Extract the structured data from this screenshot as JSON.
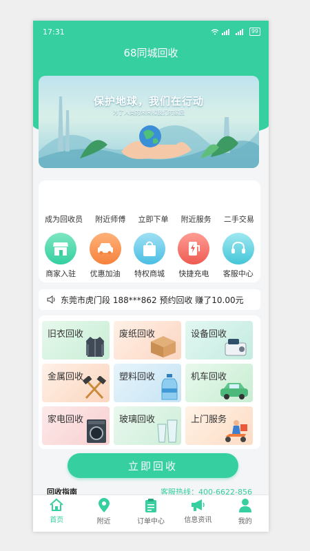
{
  "status": {
    "time": "17:31",
    "network": "⁴ᴳ",
    "battery": "99"
  },
  "app": {
    "title": "68同城回收"
  },
  "banner": {
    "title": "保护地球，我们在行动",
    "subtitle": "为了人类的未来和我们的家园"
  },
  "quick_links": [
    "成为回收员",
    "附近师傅",
    "立即下单",
    "附近服务",
    "二手交易"
  ],
  "services": [
    {
      "label": "商家入驻",
      "icon": "shop-icon",
      "color": "#4fd6a3"
    },
    {
      "label": "优惠加油",
      "icon": "car-icon",
      "color": "#f9924b"
    },
    {
      "label": "特权商城",
      "icon": "shopping-bag-icon",
      "color": "#62c9e8"
    },
    {
      "label": "快捷充电",
      "icon": "charging-station-icon",
      "color": "#f4736c"
    },
    {
      "label": "客服中心",
      "icon": "headset-icon",
      "color": "#5ed0e0"
    }
  ],
  "ticker": {
    "text": "东莞市虎门段 188***862 预约回收 赚了10.00元"
  },
  "categories": [
    {
      "label": "旧衣回收",
      "icon": "jacket-icon",
      "bg": "#d7f3df"
    },
    {
      "label": "废纸回收",
      "icon": "carton-box-icon",
      "bg": "#fde2d3"
    },
    {
      "label": "设备回收",
      "icon": "device-icon",
      "bg": "#d4f1ea"
    },
    {
      "label": "金属回收",
      "icon": "hammer-icon",
      "bg": "#fde0d0"
    },
    {
      "label": "塑料回收",
      "icon": "water-bottle-icon",
      "bg": "#d5ecf7"
    },
    {
      "label": "机车回收",
      "icon": "car-icon",
      "bg": "#d8f4e1"
    },
    {
      "label": "家电回收",
      "icon": "washing-machine-icon",
      "bg": "#fcdcdc"
    },
    {
      "label": "玻璃回收",
      "icon": "glass-icon",
      "bg": "#daf3e3"
    },
    {
      "label": "上门服务",
      "icon": "delivery-scooter-icon",
      "bg": "#fde6d4"
    }
  ],
  "cta": {
    "label": "立即回收"
  },
  "guide": {
    "title": "回收指南",
    "hotline": "客服热线：400-6622-856"
  },
  "tabs": [
    {
      "label": "首页",
      "icon": "home-icon",
      "active": true
    },
    {
      "label": "附近",
      "icon": "location-pin-icon",
      "active": false
    },
    {
      "label": "订单中心",
      "icon": "clipboard-icon",
      "active": false
    },
    {
      "label": "信息资讯",
      "icon": "megaphone-icon",
      "active": false
    },
    {
      "label": "我的",
      "icon": "user-icon",
      "active": false
    }
  ],
  "colors": {
    "accent": "#35cfa0"
  }
}
